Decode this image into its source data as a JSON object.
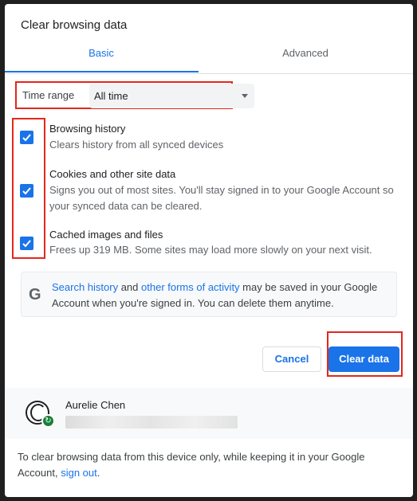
{
  "dialog": {
    "title": "Clear browsing data",
    "tabs": [
      {
        "label": "Basic"
      },
      {
        "label": "Advanced"
      }
    ],
    "time_range": {
      "label": "Time range",
      "value": "All time"
    },
    "items": [
      {
        "title": "Browsing history",
        "description": "Clears history from all synced devices",
        "checked": true
      },
      {
        "title": "Cookies and other site data",
        "description": "Signs you out of most sites. You'll stay signed in to your Google Account so your synced data can be cleared.",
        "checked": true
      },
      {
        "title": "Cached images and files",
        "description": "Frees up 319 MB. Some sites may load more slowly on your next visit.",
        "checked": true
      }
    ],
    "google_note": {
      "link1": "Search history",
      "mid1": " and ",
      "link2": "other forms of activity",
      "rest": " may be saved in your Google Account when you're signed in. You can delete them anytime."
    },
    "buttons": {
      "cancel": "Cancel",
      "clear": "Clear data"
    },
    "account": {
      "name": "Aurelie Chen"
    },
    "footer": {
      "text": "To clear browsing data from this device only, while keeping it in your Google Account, ",
      "link": "sign out",
      "end": "."
    }
  },
  "colors": {
    "accent": "#1a73e8",
    "highlight_box": "#e4271c",
    "sync_green": "#188038"
  }
}
